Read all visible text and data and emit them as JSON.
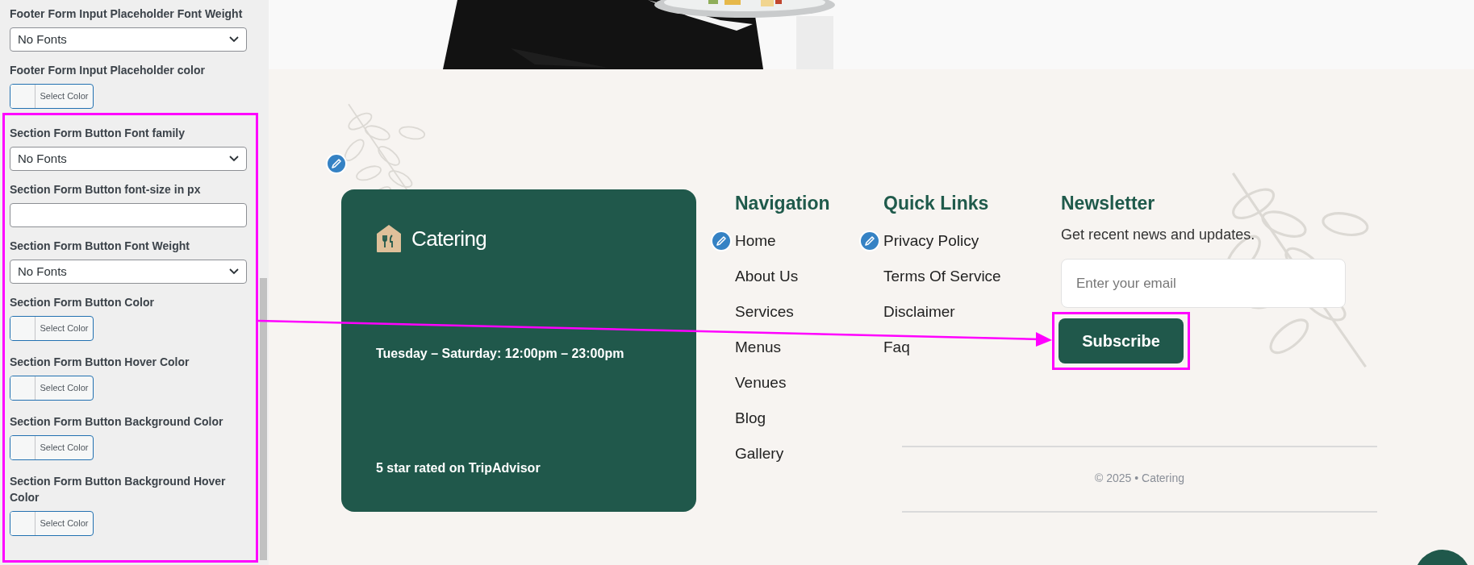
{
  "settings_panel": {
    "fields": [
      {
        "kind": "select",
        "label": "Footer Form Input Placeholder Font Weight",
        "value": "No Fonts"
      },
      {
        "kind": "color",
        "label": "Footer Form Input Placeholder color",
        "button": "Select Color"
      }
    ],
    "highlighted_group": {
      "fields": [
        {
          "kind": "select",
          "label": "Section Form Button Font family",
          "value": "No Fonts"
        },
        {
          "kind": "text",
          "label": "Section Form Button font-size in px"
        },
        {
          "kind": "select",
          "label": "Section Form Button Font Weight",
          "value": "No Fonts"
        },
        {
          "kind": "color",
          "label": "Section Form Button Color",
          "button": "Select Color"
        },
        {
          "kind": "color",
          "label": "Section Form Button Hover Color",
          "button": "Select Color"
        },
        {
          "kind": "color",
          "label": "Section Form Button Background Color",
          "button": "Select Color"
        },
        {
          "kind": "color",
          "label": "Section Form Button Background Hover Color",
          "button": "Select Color"
        }
      ]
    }
  },
  "footer": {
    "brand": "Catering",
    "hours": "Tuesday – Saturday: 12:00pm – 23:00pm",
    "rating": "5 star rated on TripAdvisor",
    "columns": [
      {
        "title": "Navigation",
        "links": [
          "Home",
          "About Us",
          "Services",
          "Menus",
          "Venues",
          "Blog",
          "Gallery"
        ]
      },
      {
        "title": "Quick Links",
        "links": [
          "Privacy Policy",
          "Terms Of Service",
          "Disclaimer",
          "Faq"
        ]
      }
    ],
    "newsletter": {
      "title": "Newsletter",
      "text": "Get recent news and updates.",
      "placeholder": "Enter your email",
      "button": "Subscribe",
      "button_highlighted": true
    },
    "copyright": "© 2025 • Catering"
  }
}
